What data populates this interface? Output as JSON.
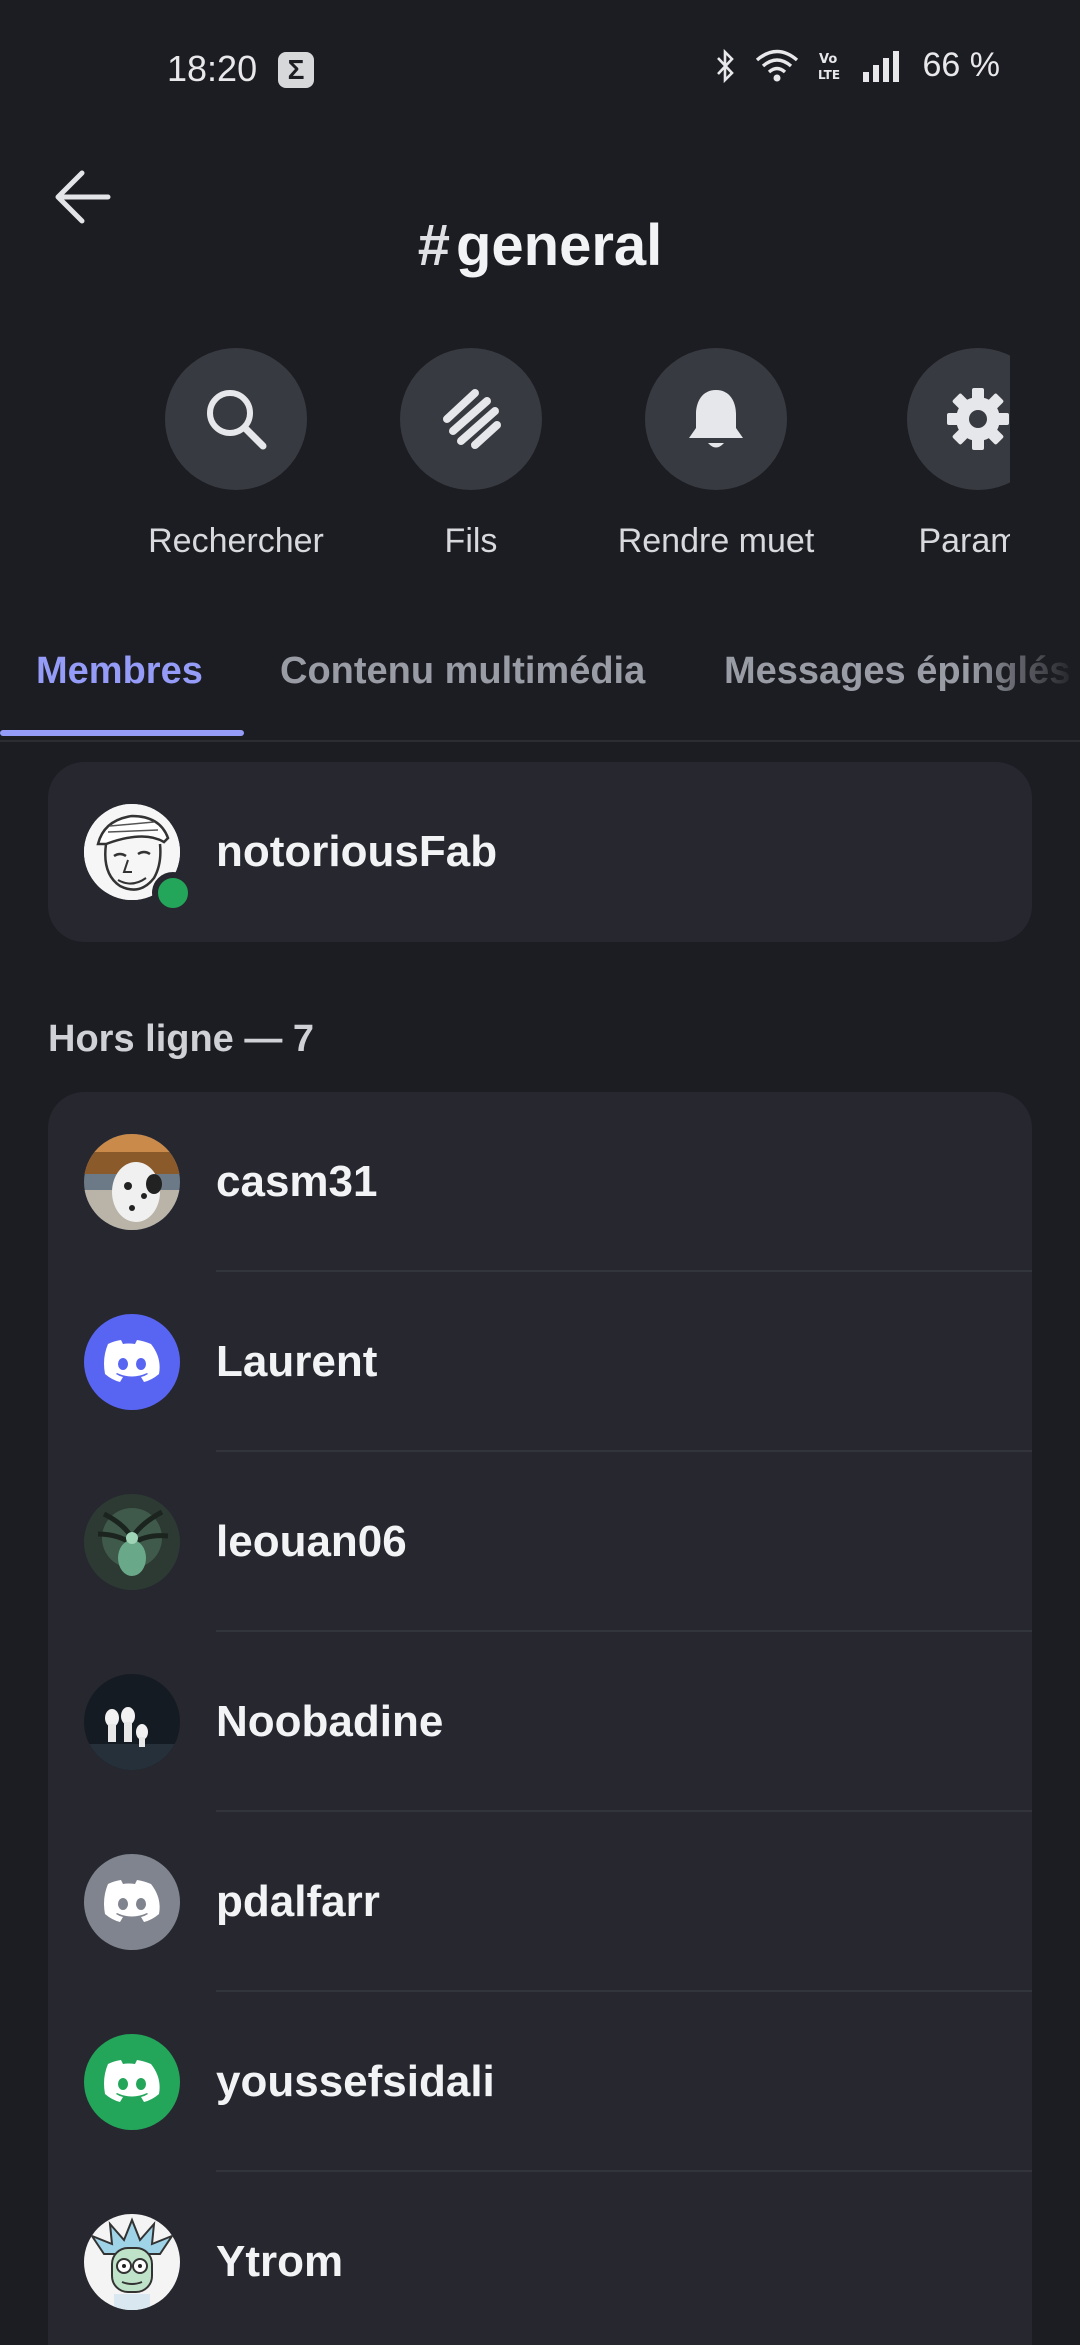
{
  "status_bar": {
    "time": "18:20",
    "battery": "66 %",
    "icons": [
      "sigma-icon",
      "bluetooth-icon",
      "wifi-icon",
      "volte-icon",
      "signal-icon"
    ]
  },
  "header": {
    "channel_hash": "#",
    "channel_name": "general"
  },
  "actions": [
    {
      "label": "Rechercher",
      "icon": "search-icon"
    },
    {
      "label": "Fils",
      "icon": "threads-icon"
    },
    {
      "label": "Rendre muet",
      "icon": "bell-icon"
    },
    {
      "label": "Paramè",
      "icon": "gear-icon"
    }
  ],
  "tabs": [
    {
      "label": "Membres",
      "active": true
    },
    {
      "label": "Contenu multimédia",
      "active": false
    },
    {
      "label": "Messages épinglés",
      "active": false
    }
  ],
  "online_members": [
    {
      "name": "notoriousFab",
      "status": "online"
    }
  ],
  "offline_section": {
    "title": "Hors ligne — 7",
    "members": [
      {
        "name": "casm31",
        "avatar": "dog-photo"
      },
      {
        "name": "Laurent",
        "avatar": "discord-default",
        "color": "#5865f2"
      },
      {
        "name": "leouan06",
        "avatar": "creature-art"
      },
      {
        "name": "Noobadine",
        "avatar": "spirits-art"
      },
      {
        "name": "pdalfarr",
        "avatar": "discord-default",
        "color": "#80848e"
      },
      {
        "name": "youssefsidali",
        "avatar": "discord-default",
        "color": "#23a55a"
      },
      {
        "name": "Ytrom",
        "avatar": "rick-cartoon"
      }
    ]
  },
  "colors": {
    "background": "#1c1d22",
    "card": "#26272f",
    "accent": "#949cf7",
    "online": "#23a55a"
  }
}
